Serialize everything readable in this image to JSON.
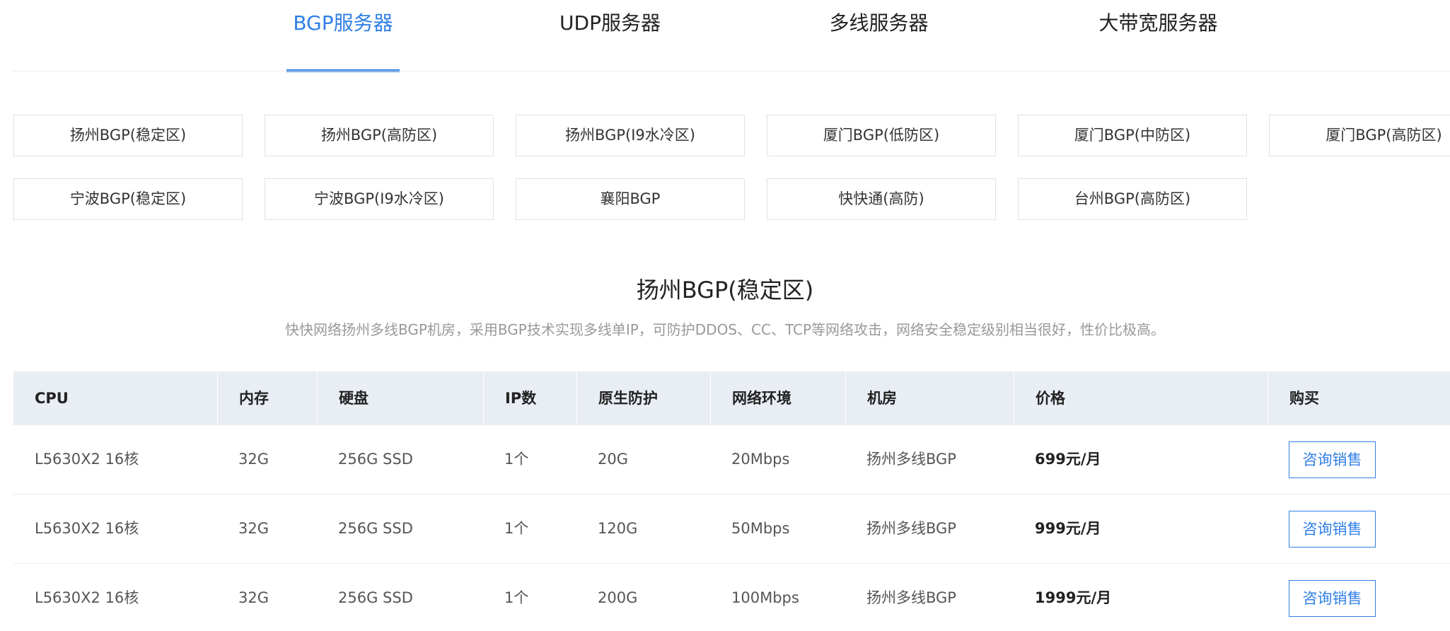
{
  "tabs": [
    {
      "label": "BGP服务器",
      "active": true
    },
    {
      "label": "UDP服务器",
      "active": false
    },
    {
      "label": "多线服务器",
      "active": false
    },
    {
      "label": "大带宽服务器",
      "active": false
    }
  ],
  "regions": [
    "扬州BGP(稳定区)",
    "扬州BGP(高防区)",
    "扬州BGP(I9水冷区)",
    "厦门BGP(低防区)",
    "厦门BGP(中防区)",
    "厦门BGP(高防区)",
    "宁波BGP(稳定区)",
    "宁波BGP(I9水冷区)",
    "襄阳BGP",
    "快快通(高防)",
    "台州BGP(高防区)"
  ],
  "section": {
    "title": "扬州BGP(稳定区)",
    "description": "快快网络扬州多线BGP机房，采用BGP技术实现多线单IP，可防护DDOS、CC、TCP等网络攻击，网络安全稳定级别相当很好，性价比极高。"
  },
  "table": {
    "headers": [
      "CPU",
      "内存",
      "硬盘",
      "IP数",
      "原生防护",
      "网络环境",
      "机房",
      "价格",
      "购买"
    ],
    "rows": [
      {
        "cpu": "L5630X2 16核",
        "memory": "32G",
        "disk": "256G SSD",
        "ip": "1个",
        "defense": "20G",
        "network": "20Mbps",
        "room": "扬州多线BGP",
        "price": "699元/月",
        "action": "咨询销售"
      },
      {
        "cpu": "L5630X2 16核",
        "memory": "32G",
        "disk": "256G SSD",
        "ip": "1个",
        "defense": "120G",
        "network": "50Mbps",
        "room": "扬州多线BGP",
        "price": "999元/月",
        "action": "咨询销售"
      },
      {
        "cpu": "L5630X2 16核",
        "memory": "32G",
        "disk": "256G SSD",
        "ip": "1个",
        "defense": "200G",
        "network": "100Mbps",
        "room": "扬州多线BGP",
        "price": "1999元/月",
        "action": "咨询销售"
      }
    ]
  },
  "colors": {
    "accent": "#2f7fe6",
    "table_header_bg": "#e9edf4",
    "muted_text": "#999999"
  }
}
